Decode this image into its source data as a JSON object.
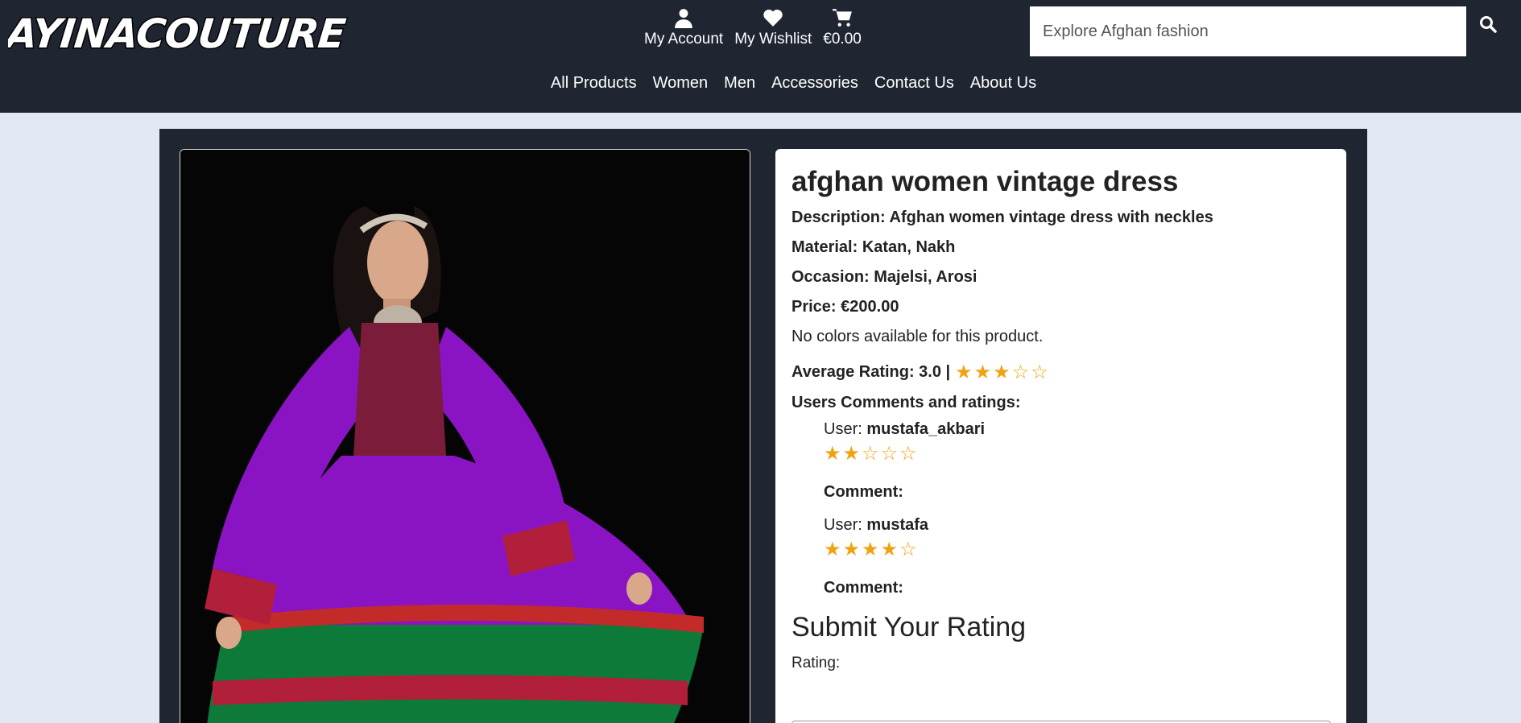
{
  "brand": {
    "logo_text": "AYINACOUTURE"
  },
  "header": {
    "account_label": "My Account",
    "wishlist_label": "My Wishlist",
    "cart_total": "€0.00",
    "search_placeholder": "Explore Afghan fashion",
    "icons": [
      "user-icon",
      "heart-icon",
      "cart-icon",
      "search-icon"
    ]
  },
  "menu": {
    "items": [
      "All Products",
      "Women",
      "Men",
      "Accessories",
      "Contact Us",
      "About Us"
    ]
  },
  "product": {
    "title": "afghan women vintage dress",
    "description_label": "Description:",
    "description": "Afghan women vintage dress with neckles",
    "material_label": "Material:",
    "material": "Katan, Nakh",
    "occasion_label": "Occasion:",
    "occasion": "Majelsi, Arosi",
    "price_label": "Price:",
    "price": "€200.00",
    "colors_note": "No colors available for this product.",
    "avg_rating_label": "Average Rating: 3.0 |",
    "avg_rating": 3.0,
    "avg_stars": "★★★☆☆"
  },
  "reviews": {
    "heading": "Users Comments and ratings:",
    "user_label": "User:",
    "comment_label": "Comment:",
    "items": [
      {
        "user": "mustafa_akbari",
        "rating": 2,
        "stars": "★★☆☆☆"
      },
      {
        "user": "mustafa",
        "rating": 4,
        "stars": "★★★★☆"
      }
    ]
  },
  "rating_form": {
    "heading": "Submit Your Rating",
    "rating_label": "Rating:"
  },
  "colors": {
    "header_bg": "#1f2531",
    "page_bg": "#e2e8f4",
    "star": "#f0a312",
    "dress_purple": "#8a14c4",
    "dress_green": "#0d7a3a"
  }
}
